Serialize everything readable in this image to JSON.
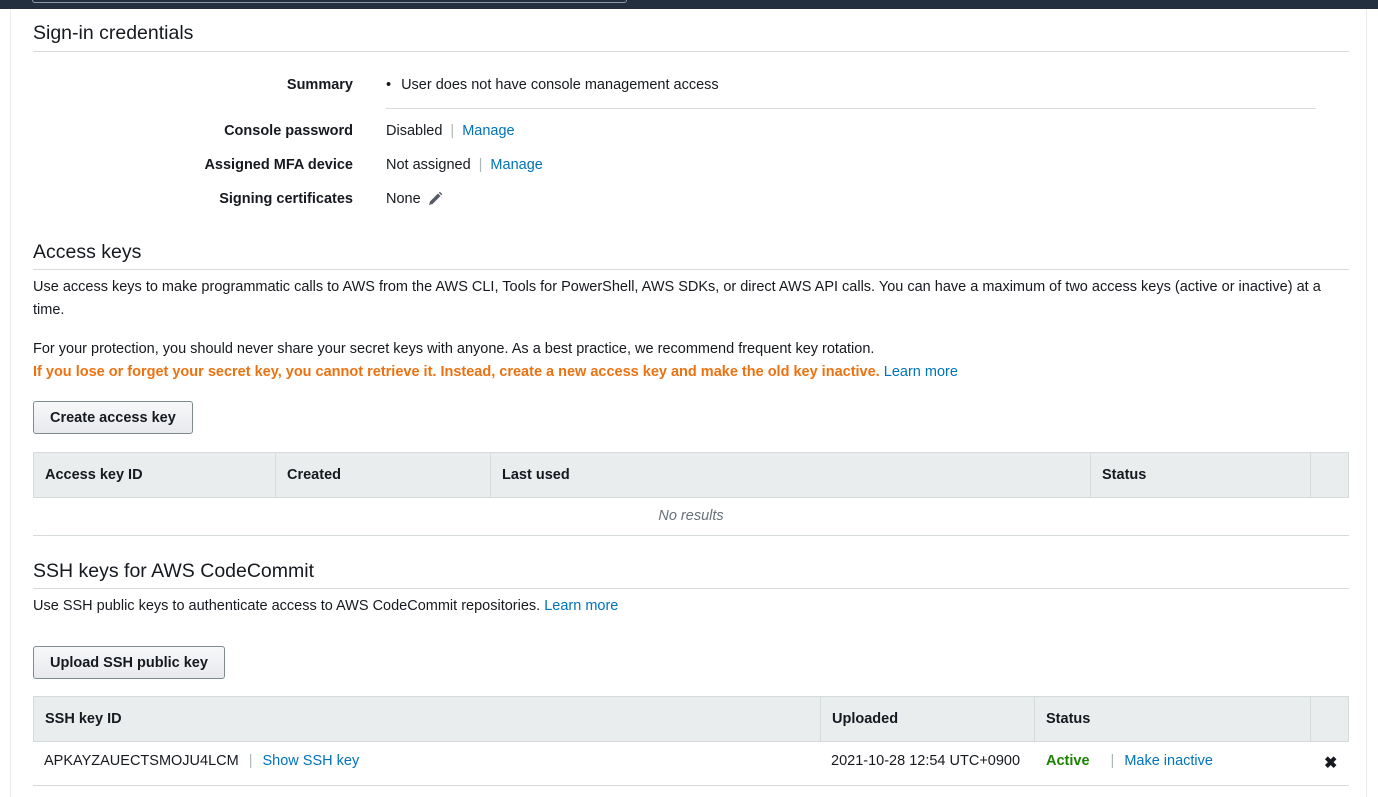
{
  "signin": {
    "title": "Sign-in credentials",
    "summary_label": "Summary",
    "summary_bullet": "User does not have console management access",
    "console_password_label": "Console password",
    "console_password_value": "Disabled",
    "console_password_link": "Manage",
    "mfa_label": "Assigned MFA device",
    "mfa_value": "Not assigned",
    "mfa_link": "Manage",
    "signing_label": "Signing certificates",
    "signing_value": "None",
    "separator": "|"
  },
  "access_keys": {
    "title": "Access keys",
    "description": "Use access keys to make programmatic calls to AWS from the AWS CLI, Tools for PowerShell, AWS SDKs, or direct AWS API calls. You can have a maximum of two access keys (active or inactive) at a time.",
    "protection": "For your protection, you should never share your secret keys with anyone. As a best practice, we recommend frequent key rotation.",
    "warning": "If you lose or forget your secret key, you cannot retrieve it. Instead, create a new access key and make the old key inactive.",
    "learn_more": "Learn more",
    "create_button": "Create access key",
    "columns": [
      "Access key ID",
      "Created",
      "Last used",
      "Status"
    ],
    "empty": "No results"
  },
  "ssh_keys": {
    "title": "SSH keys for AWS CodeCommit",
    "description": "Use SSH public keys to authenticate access to AWS CodeCommit repositories.",
    "learn_more": "Learn more",
    "upload_button": "Upload SSH public key",
    "columns": [
      "SSH key ID",
      "Uploaded",
      "Status"
    ],
    "rows": [
      {
        "key_id": "APKAYZAUECTSMOJU4LCM",
        "show_link": "Show SSH key",
        "uploaded": "2021-10-28 12:54 UTC+0900",
        "status": "Active",
        "action": "Make inactive",
        "delete_icon": "✖"
      }
    ]
  },
  "colors": {
    "link": "#0073bb",
    "warning": "#ec7211",
    "active": "#1d8102",
    "header_bg": "#eaeded",
    "topbar": "#232f3e"
  },
  "icons": {
    "edit": "pencil-icon",
    "delete": "close-icon"
  }
}
